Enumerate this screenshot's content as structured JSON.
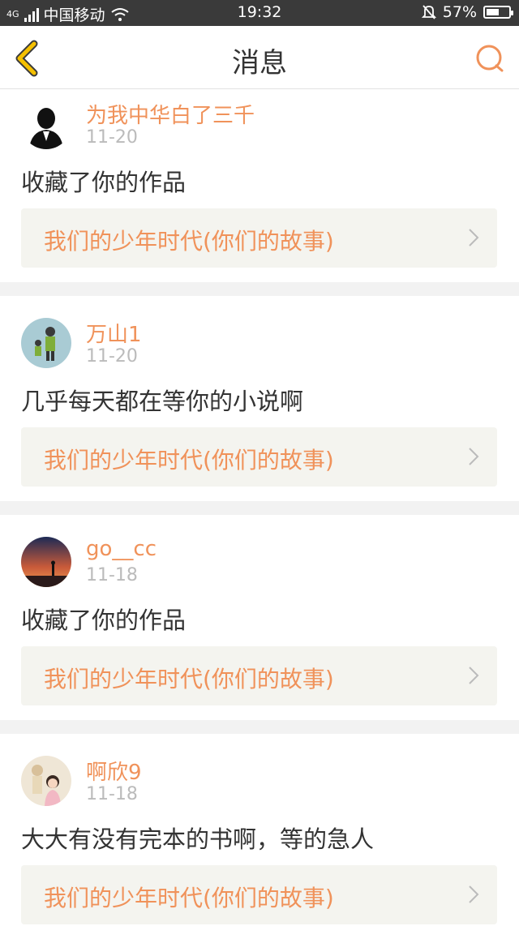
{
  "status_bar": {
    "network": "4G",
    "carrier": "中国移动",
    "time": "19:32",
    "battery": "57%",
    "battery_level": 0.57
  },
  "header": {
    "title": "消息"
  },
  "messages": [
    {
      "user": "为我中华白了三千",
      "date": "11-20",
      "text": "收藏了你的作品",
      "work": "我们的少年时代(你们的故事)"
    },
    {
      "user": "万山1",
      "date": "11-20",
      "text": "几乎每天都在等你的小说啊",
      "work": "我们的少年时代(你们的故事)"
    },
    {
      "user": "go__cc",
      "date": "11-18",
      "text": "收藏了你的作品",
      "work": "我们的少年时代(你们的故事)"
    },
    {
      "user": "啊欣9",
      "date": "11-18",
      "text": "大大有没有完本的书啊，等的急人",
      "work": "我们的少年时代(你们的故事)"
    }
  ],
  "colors": {
    "accent": "#f0925a",
    "back_icon": "#f5c000"
  }
}
